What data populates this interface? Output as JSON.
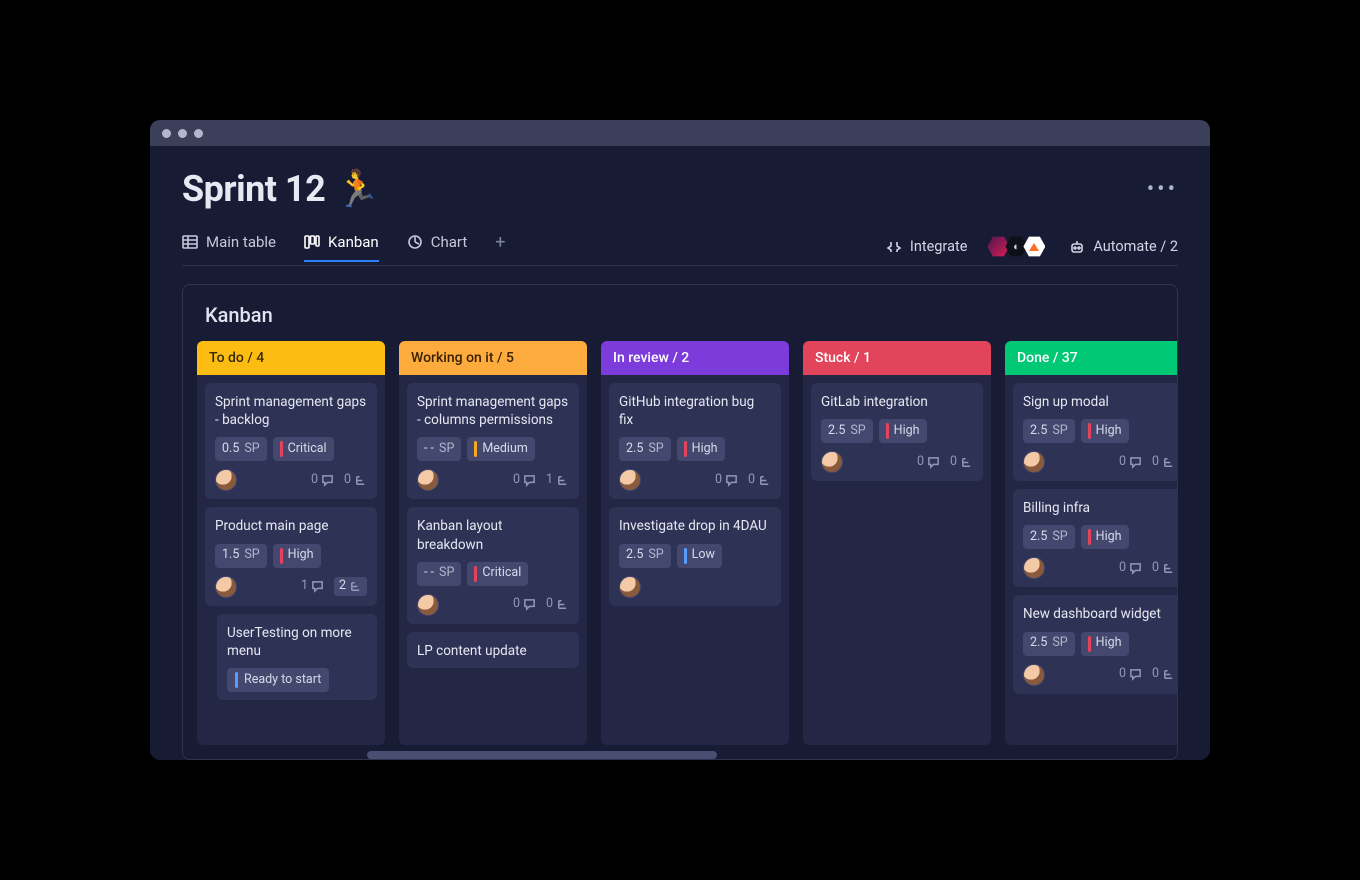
{
  "header": {
    "title": "Sprint 12",
    "emoji": "🏃"
  },
  "tabs": [
    {
      "label": "Main table",
      "icon": "table"
    },
    {
      "label": "Kanban",
      "icon": "kanban"
    },
    {
      "label": "Chart",
      "icon": "chart"
    }
  ],
  "actions": {
    "integrate": "Integrate",
    "automate": "Automate / 2"
  },
  "board": {
    "title": "Kanban"
  },
  "columns": [
    {
      "name": "To do",
      "count": 4,
      "color": "#fdbc11",
      "text": "#3a2d00",
      "cards": [
        {
          "title": "Sprint management gaps - backlog",
          "sp": "0.5",
          "priority": "Critical",
          "pcolor": "red",
          "comments": 0,
          "subs": 0
        },
        {
          "title": "Product main page",
          "sp": "1.5",
          "priority": "High",
          "pcolor": "red",
          "comments": 1,
          "subs": 2,
          "subsBoxed": true
        },
        {
          "title": "UserTesting on more menu",
          "status": "Ready to start",
          "statusColor": "blue",
          "sub": true
        }
      ]
    },
    {
      "name": "Working on it",
      "count": 5,
      "color": "#fdab3d",
      "text": "#3a2200",
      "cards": [
        {
          "title": "Sprint management gaps - columns permissions",
          "sp": "- -",
          "priority": "Medium",
          "pcolor": "orange",
          "comments": 0,
          "subs": 1
        },
        {
          "title": "Kanban layout breakdown",
          "sp": "- -",
          "priority": "Critical",
          "pcolor": "red",
          "comments": 0,
          "subs": 0
        },
        {
          "title": "LP content update"
        }
      ]
    },
    {
      "name": "In review",
      "count": 2,
      "color": "#7b3cdb",
      "text": "#fff",
      "cards": [
        {
          "title": "GitHub integration bug fix",
          "sp": "2.5",
          "priority": "High",
          "pcolor": "red",
          "comments": 0,
          "subs": 0
        },
        {
          "title": "Investigate drop in 4DAU",
          "sp": "2.5",
          "priority": "Low",
          "pcolor": "blue"
        }
      ]
    },
    {
      "name": "Stuck",
      "count": 1,
      "color": "#e2445c",
      "text": "#fff",
      "cards": [
        {
          "title": "GitLab integration",
          "sp": "2.5",
          "priority": "High",
          "pcolor": "red",
          "comments": 0,
          "subs": 0
        }
      ]
    },
    {
      "name": "Done",
      "count": 37,
      "color": "#00c875",
      "text": "#fff",
      "cards": [
        {
          "title": "Sign up modal",
          "sp": "2.5",
          "priority": "High",
          "pcolor": "red",
          "comments": 0,
          "subs": 0
        },
        {
          "title": "Billing infra",
          "sp": "2.5",
          "priority": "High",
          "pcolor": "red",
          "comments": 0,
          "subs": 0
        },
        {
          "title": "New dashboard widget",
          "sp": "2.5",
          "priority": "High",
          "pcolor": "red",
          "comments": 0,
          "subs": 0
        }
      ]
    }
  ]
}
